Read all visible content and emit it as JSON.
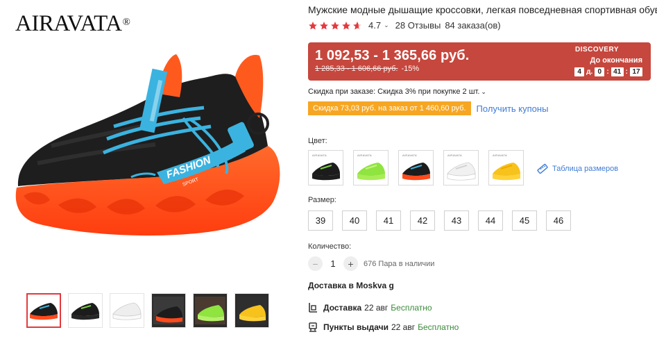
{
  "brand": {
    "name": "AIRAVATA",
    "mark": "®"
  },
  "product": {
    "title": "Мужские модные дышащие кроссовки, легкая повседневная спортивная обувь",
    "rating": "4.7",
    "reviews": "28 Отзывы",
    "orders": "84 заказа(ов)",
    "main_image_text": "FASHION",
    "main_image_subtext": "SPORT"
  },
  "price": {
    "range": "1 092,53 - 1 365,66 руб.",
    "old_range": "1 285,33 - 1 606,66 руб.",
    "discount": "-15%",
    "promo_label": "DISCOVERY",
    "ends_label": "До окончания",
    "timer": {
      "days": "4",
      "days_unit": "д.",
      "hours": "0",
      "minutes": "41",
      "seconds": "17"
    }
  },
  "order_discount": "Скидка при заказе: Скидка 3% при покупке 2 шт.",
  "coupon": {
    "tag": "Скидка 73,03 руб. на заказ от 1 460,60 руб.",
    "link": "Получить купоны"
  },
  "color_section": {
    "label": "Цвет:",
    "size_table": "Таблица размеров",
    "tiny_brand": "AIRAVATA",
    "options": [
      {
        "upper": "#1c1c1c",
        "sole": "#1e1e1e",
        "accent": "#7ad63c"
      },
      {
        "upper": "#8fe43f",
        "sole": "#a8ec56",
        "accent": "#c7f38a"
      },
      {
        "upper": "#1c1c1c",
        "sole": "#ff4a1c",
        "accent": "#3bb3e0"
      },
      {
        "upper": "#f1f1f1",
        "sole": "#ffffff",
        "accent": "#d4d4d4"
      },
      {
        "upper": "#f7c21c",
        "sole": "#ffd23a",
        "accent": "#f0a800"
      }
    ]
  },
  "size_section": {
    "label": "Размер:",
    "sizes": [
      "39",
      "40",
      "41",
      "42",
      "43",
      "44",
      "45",
      "46"
    ]
  },
  "quantity": {
    "label": "Количество:",
    "value": "1",
    "minus": "−",
    "plus": "+",
    "stock": "676 Пара в наличии"
  },
  "delivery": {
    "title": "Доставка в Moskva g",
    "rows": [
      {
        "name": "Доставка",
        "date": "22 авг",
        "cost": "Бесплатно"
      },
      {
        "name": "Пункты выдачи",
        "date": "22 авг",
        "cost": "Бесплатно"
      }
    ]
  },
  "colors": {
    "price_bg": "#c6473d",
    "coupon_bg": "#f6a623",
    "link": "#3f7bd6",
    "star": "#e4393c",
    "free": "#3a8a3a"
  }
}
